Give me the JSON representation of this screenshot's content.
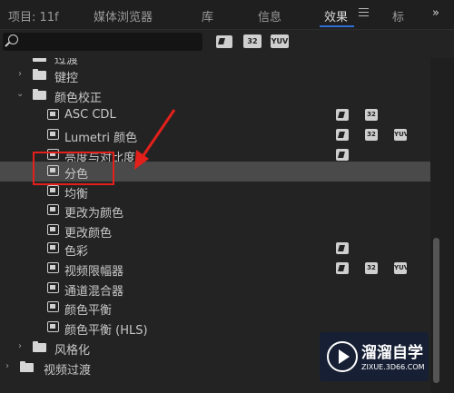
{
  "tabs": [
    {
      "label": "项目: 11f",
      "active": false
    },
    {
      "label": "媒体浏览器",
      "active": false
    },
    {
      "label": "库",
      "active": false
    },
    {
      "label": "信息",
      "active": false
    },
    {
      "label": "效果",
      "active": true
    },
    {
      "label": "标",
      "active": false
    }
  ],
  "overflow_icon": "double-chevron-right",
  "search": {
    "placeholder": "",
    "value": ""
  },
  "filters": [
    "accelerated-effects",
    "32",
    "YUV"
  ],
  "tree": {
    "partial_top": "过渡",
    "folders": [
      {
        "label": "键控",
        "expanded": false
      },
      {
        "label": "颜色校正",
        "expanded": true
      }
    ],
    "effects": [
      {
        "label": "ASC CDL",
        "badges": [
          "accel",
          "32"
        ]
      },
      {
        "label": "Lumetri 颜色",
        "badges": [
          "accel",
          "32",
          "YUV"
        ]
      },
      {
        "label": "亮度与对比度",
        "badges": [
          "accel"
        ]
      },
      {
        "label": "分色",
        "badges": [],
        "selected": true
      },
      {
        "label": "均衡",
        "badges": []
      },
      {
        "label": "更改为颜色",
        "badges": []
      },
      {
        "label": "更改颜色",
        "badges": []
      },
      {
        "label": "色彩",
        "badges": [
          "accel"
        ]
      },
      {
        "label": "视频限幅器",
        "badges": [
          "accel",
          "32",
          "YUV"
        ]
      },
      {
        "label": "通道混合器",
        "badges": []
      },
      {
        "label": "颜色平衡",
        "badges": []
      },
      {
        "label": "颜色平衡 (HLS)",
        "badges": []
      }
    ],
    "after_folders": [
      {
        "label": "风格化",
        "expanded": false
      },
      {
        "label": "视频过渡",
        "expanded": false
      }
    ]
  },
  "badge_labels": {
    "b32": "32",
    "yuv": "YUV"
  },
  "watermark": {
    "title": "溜溜自学",
    "url": "ZIXUE.3D66.COM"
  },
  "colors": {
    "accent": "#2f6fd6",
    "highlight": "#e3201b",
    "selected_row": "#4a4a4a"
  }
}
